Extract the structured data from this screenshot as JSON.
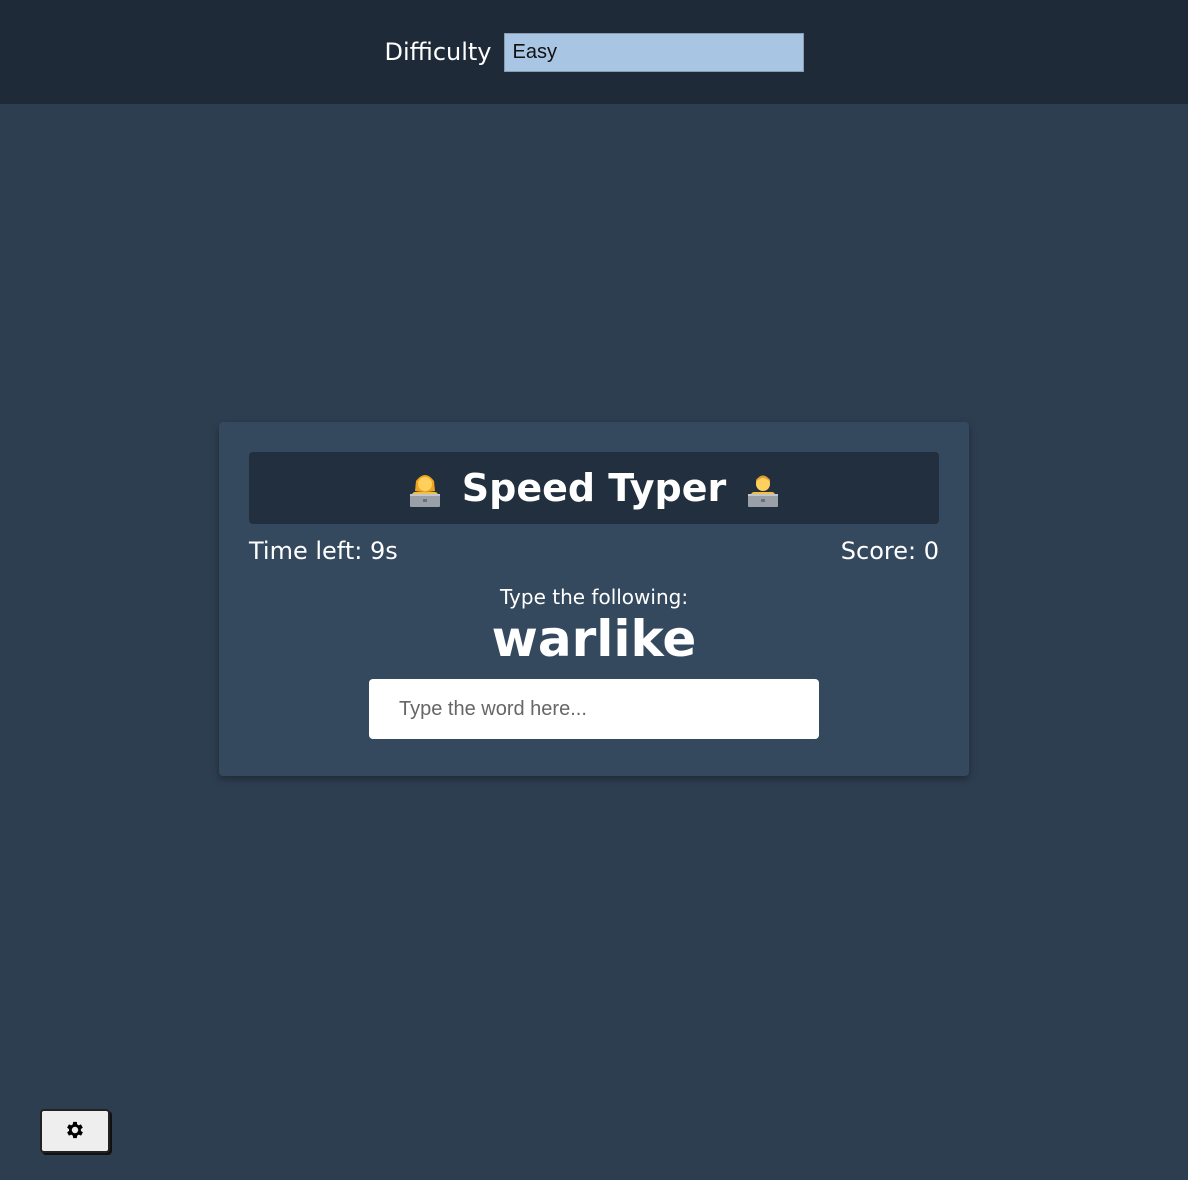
{
  "settings": {
    "difficulty_label": "Difficulty",
    "difficulty_selected": "Easy"
  },
  "game": {
    "title": "Speed Typer",
    "time_left_label": "Time left: 9s",
    "score_label": "Score: 0",
    "prompt_label": "Type the following:",
    "current_word": "warlike",
    "input_placeholder": "Type the word here...",
    "input_value": ""
  },
  "icons": {
    "left": "woman-technologist-icon",
    "right": "man-technologist-icon",
    "settings": "gear-icon"
  },
  "colors": {
    "page_bg": "#2e3e51",
    "settings_bar_bg": "#1f2a38",
    "card_bg": "#34495e",
    "title_bg": "#222f3e",
    "select_bg": "#a8c6e4"
  }
}
